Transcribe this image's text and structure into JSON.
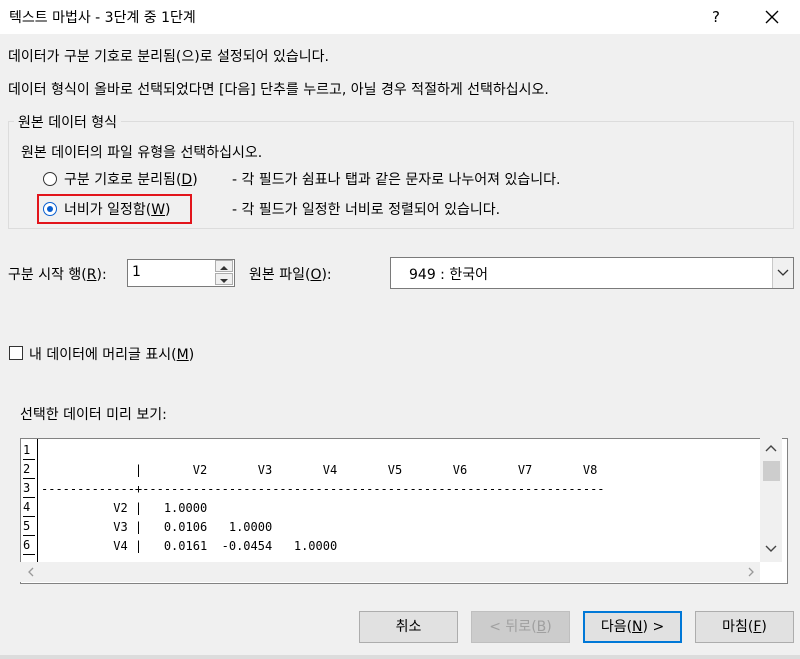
{
  "window": {
    "title": "텍스트 마법사 - 3단계 중 1단계",
    "help_label": "?",
    "close_icon": "close-icon"
  },
  "intro": {
    "line1": "데이터가 구분 기호로 분리됨(으)로 설정되어 있습니다.",
    "line2": "데이터 형식이 올바로 선택되었다면 [다음] 단추를 누르고, 아닐 경우 적절하게 선택하십시오."
  },
  "original_data_type": {
    "legend": "원본 데이터 형식",
    "prompt": "원본 데이터의 파일 유형을 선택하십시오.",
    "options": [
      {
        "label_pre": "구분 기호로 분리됨(",
        "accel": "D",
        "label_post": ")",
        "desc": "- 각 필드가 쉼표나 탭과 같은 문자로 나누어져 있습니다.",
        "selected": false
      },
      {
        "label_pre": "너비가 일정함(",
        "accel": "W",
        "label_post": ")",
        "desc": "- 각 필드가 일정한 너비로 정렬되어 있습니다.",
        "selected": true
      }
    ],
    "highlight_color": "#e2141b"
  },
  "start_row": {
    "label_pre": "구분 시작 행(",
    "accel": "R",
    "label_post": "):",
    "value": "1"
  },
  "file_origin": {
    "label_pre": "원본 파일(",
    "accel": "O",
    "label_post": "):",
    "value": "949 : 한국어"
  },
  "headers_checkbox": {
    "label_pre": "내 데이터에 머리글 표시(",
    "accel": "M",
    "label_post": ")",
    "checked": false
  },
  "preview": {
    "label": "선택한 데이터 미리 보기:",
    "line_numbers": [
      "1",
      "2",
      "3",
      "4",
      "5",
      "6"
    ],
    "lines": [
      "",
      "             |       V2       V3       V4       V5       V6       V7       V8",
      "-------------+----------------------------------------------------------------",
      "          V2 |   1.0000",
      "          V3 |   0.0106   1.0000",
      "          V4 |   0.0161  -0.0454   1.0000"
    ]
  },
  "buttons": {
    "cancel": "취소",
    "back_pre": "< 뒤로(",
    "back_accel": "B",
    "back_post": ")",
    "next_pre": "다음(",
    "next_accel": "N",
    "next_post": ") >",
    "finish_pre": "마침(",
    "finish_accel": "F",
    "finish_post": ")"
  },
  "colors": {
    "accent": "#0078d7",
    "background": "#f0f0f0"
  }
}
